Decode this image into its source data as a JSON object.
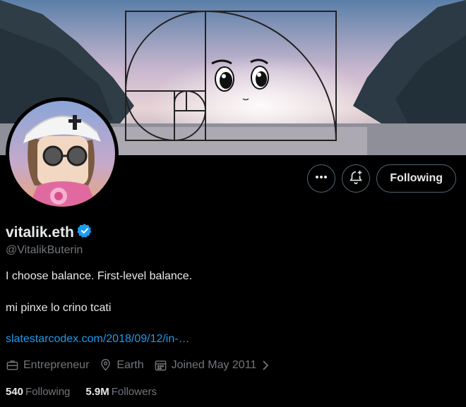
{
  "profile": {
    "display_name": "vitalik.eth",
    "handle": "@VitalikButerin",
    "bio_line1": "I choose balance. First-level balance.",
    "bio_line2": "mi pinxe lo crino tcati",
    "link": "slatestarcodex.com/2018/09/12/in-…",
    "verified_icon": "verified-badge-icon",
    "verified_color": "#1d9bf0"
  },
  "actions": {
    "more_icon": "more-dots-icon",
    "notify_icon": "bell-plus-icon",
    "following_label": "Following"
  },
  "meta": {
    "profession": "Entrepreneur",
    "location": "Earth",
    "joined": "Joined May 2011"
  },
  "stats": {
    "following_count": "540",
    "following_label": "Following",
    "followers_count": "5.9M",
    "followers_label": "Followers"
  },
  "colors": {
    "background": "#000000",
    "text": "#e7e9ea",
    "muted": "#71767b",
    "link": "#1d9bf0",
    "border": "#536471"
  }
}
